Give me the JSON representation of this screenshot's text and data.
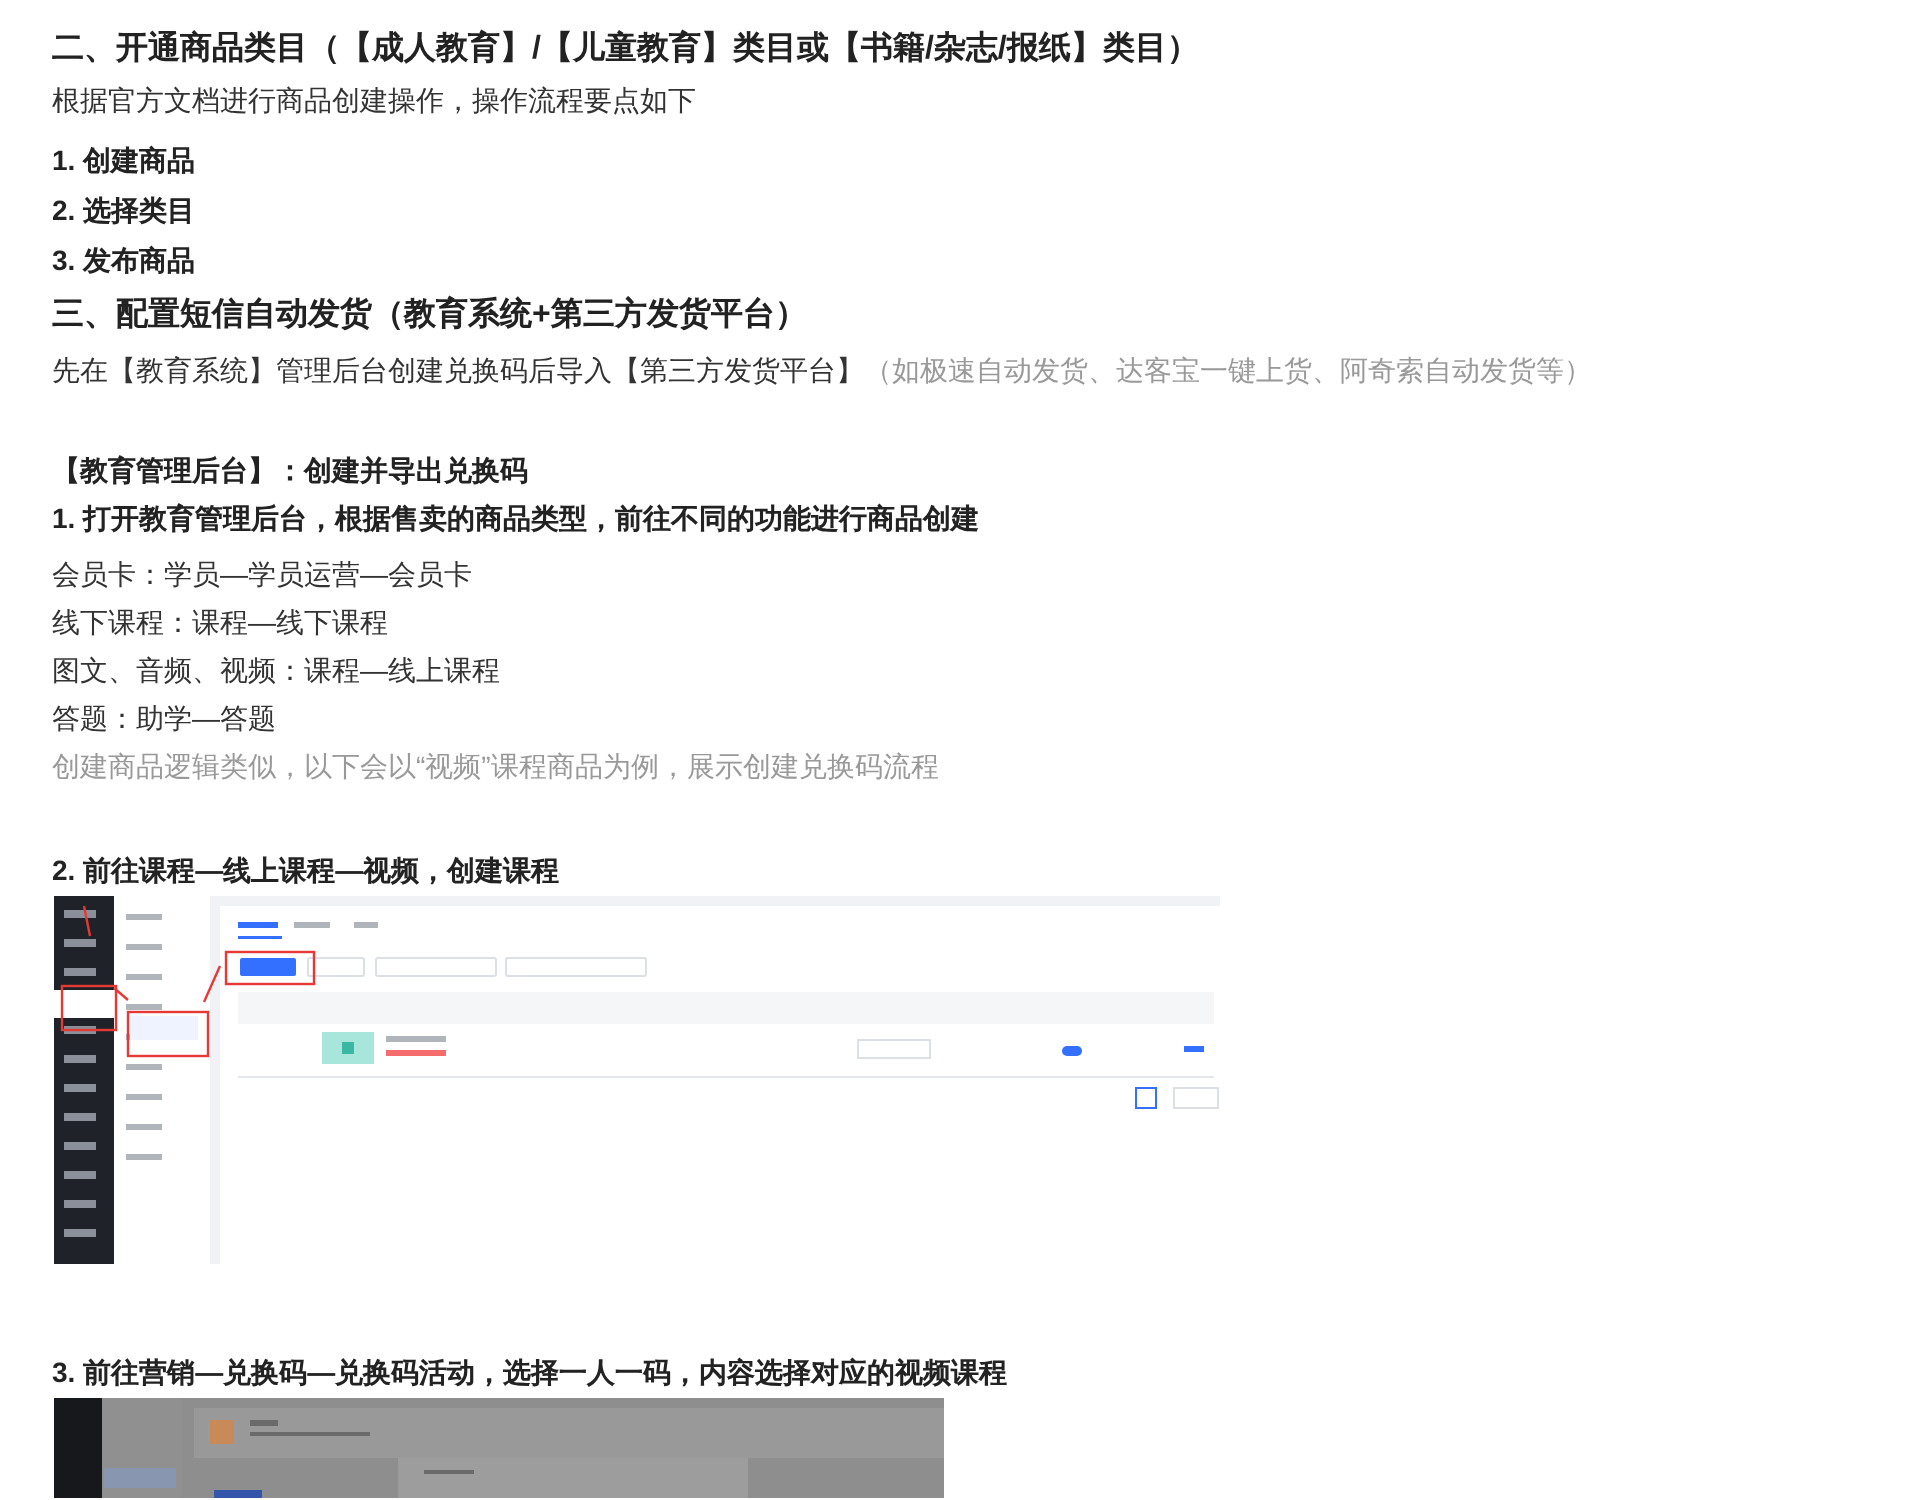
{
  "section_2": {
    "heading": "二、开通商品类目（【成人教育】/【儿童教育】类目或【书籍/杂志/报纸】类目）",
    "intro": "根据官方文档进行商品创建操作，操作流程要点如下",
    "steps": [
      "1. 创建商品",
      "2. 选择类目",
      "3. 发布商品"
    ]
  },
  "section_3": {
    "heading": "三、配置短信自动发货（教育系统+第三方发货平台）",
    "intro": "先在【教育系统】管理后台创建兑换码后导入【第三方发货平台】",
    "intro_note": "（如极速自动发货、达客宝一键上货、阿奇索自动发货等）",
    "subheading": "【教育管理后台】：创建并导出兑换码",
    "step_1": "1. 打开教育管理后台，根据售卖的商品类型，前往不同的功能进行商品创建",
    "mappings": [
      {
        "text": "会员卡：学员—学员运营—会员卡",
        "kind": "normal"
      },
      {
        "text": "线下课程：课程—线下课程",
        "kind": "normal"
      },
      {
        "text": "图文、音频、视频：课程—线上课程",
        "kind": "normal"
      },
      {
        "text": "答题：助学—答题",
        "kind": "normal"
      },
      {
        "text": "创建商品逻辑类似，以下会以“视频”课程商品为例，展示创建兑换码流程",
        "kind": "note"
      }
    ],
    "step_2": "2. 前往课程—线上课程—视频，创建课程",
    "step_3": "3. 前往营销—兑换码—兑换码活动，选择一人一码，内容选择对应的视频课程"
  }
}
